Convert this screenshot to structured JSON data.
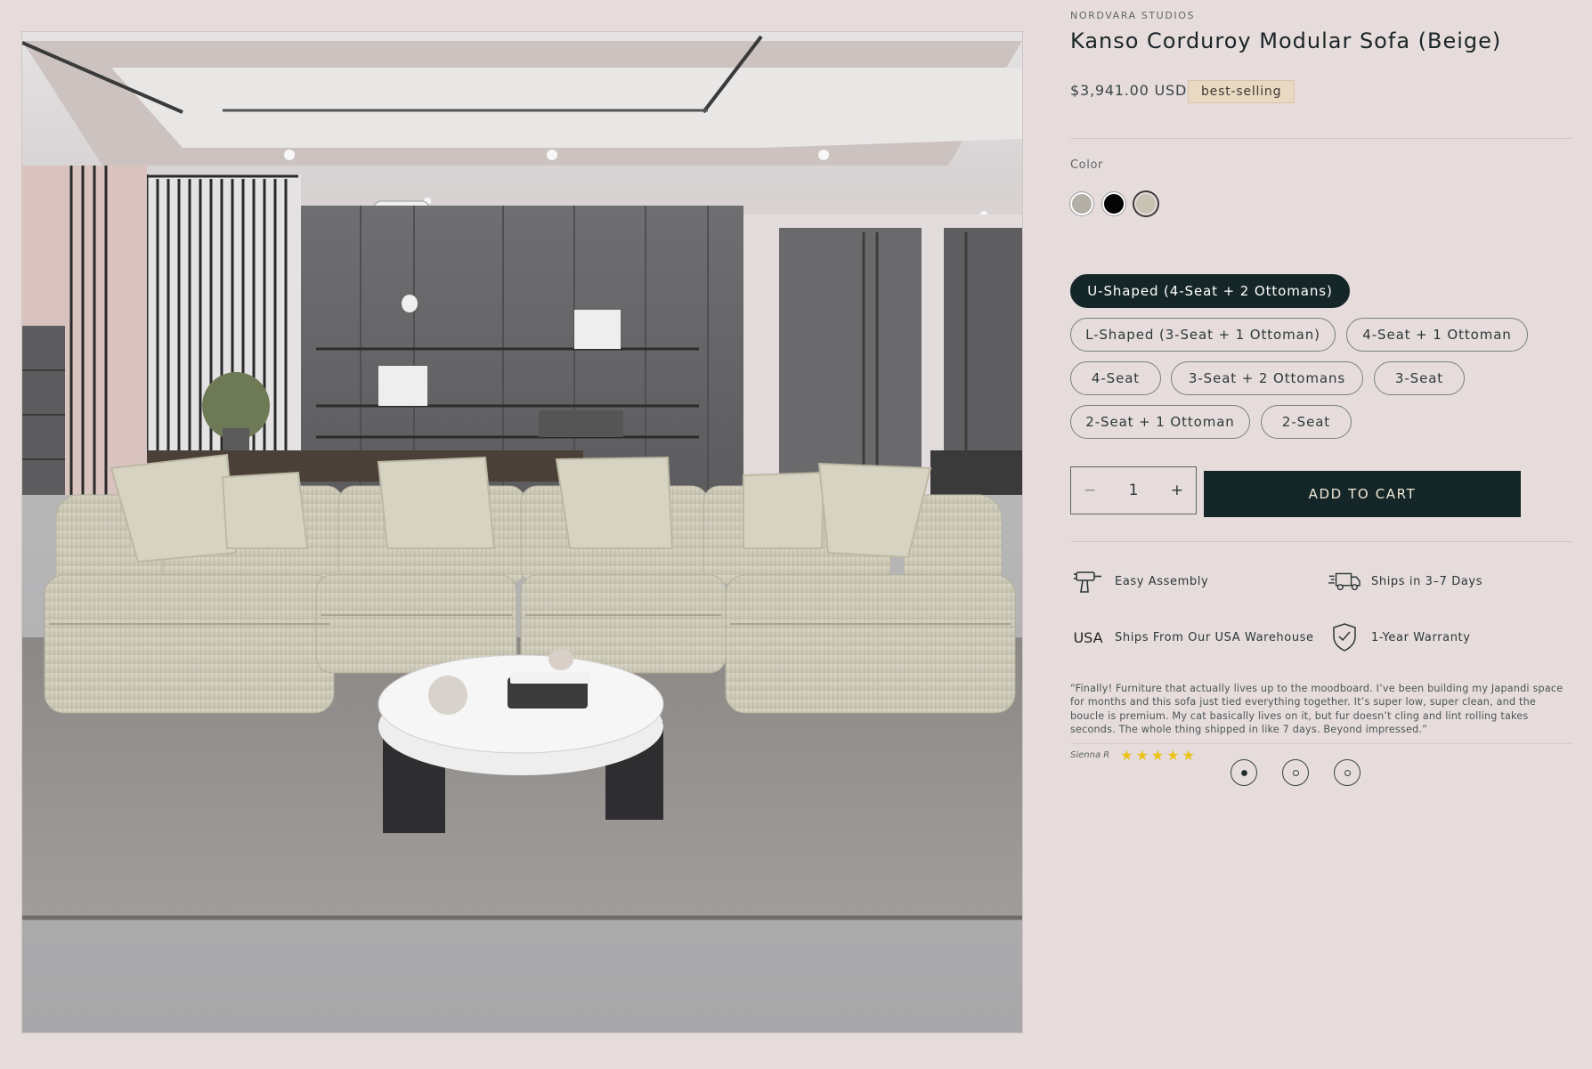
{
  "product": {
    "vendor": "NORDVARA STUDIOS",
    "title": "Kanso Corduroy Modular Sofa (Beige)",
    "price": "$3,941.00 USD",
    "badge": "best-selling",
    "color_label": "Color",
    "colors": [
      {
        "name": "beige-grey",
        "hex": "#b4afa6"
      },
      {
        "name": "black",
        "hex": "#050505"
      },
      {
        "name": "sage-beige",
        "hex": "#c6c3b3",
        "selected": true
      }
    ]
  },
  "variants": [
    "U-Shaped (4-Seat + 2 Ottomans)",
    "L-Shaped (3-Seat + 1 Ottoman)",
    "4-Seat + 1 Ottoman",
    "4-Seat",
    "3-Seat + 2 Ottomans",
    "3-Seat",
    "2-Seat + 1 Ottoman",
    "2-Seat"
  ],
  "selected_variant": "U-Shaped (4-Seat + 2 Ottomans)",
  "quantity": {
    "minus": "−",
    "value": "1",
    "plus": "+"
  },
  "add_to_cart": "ADD TO CART",
  "features": [
    {
      "icon": "drill-icon",
      "label": "Easy Assembly"
    },
    {
      "icon": "delivery-truck-icon",
      "label": "Ships in 3–7 Days"
    },
    {
      "icon": "usa-text-icon",
      "icon_text": "USA",
      "label": "Ships From Our USA Warehouse"
    },
    {
      "icon": "shield-check-icon",
      "label": "1-Year Warranty"
    }
  ],
  "review": {
    "text": "“Finally! Furniture that actually lives up to the moodboard. I’ve been building my Japandi space for months and this sofa just tied everything together. It’s super low, super clean, and the boucle is premium. My cat basically lives on it, but fur doesn’t cling and lint rolling takes seconds. The whole thing shipped in like 7 days. Beyond impressed.”",
    "author": "Sienna R",
    "rating": 5,
    "stars": "★★★★★"
  },
  "carousel": {
    "count": 3,
    "active_index": 0
  },
  "colors": {
    "accent": "#152628",
    "background": "#e6dcdb",
    "badge_bg": "#ead9c2",
    "star": "#ecc11a"
  }
}
